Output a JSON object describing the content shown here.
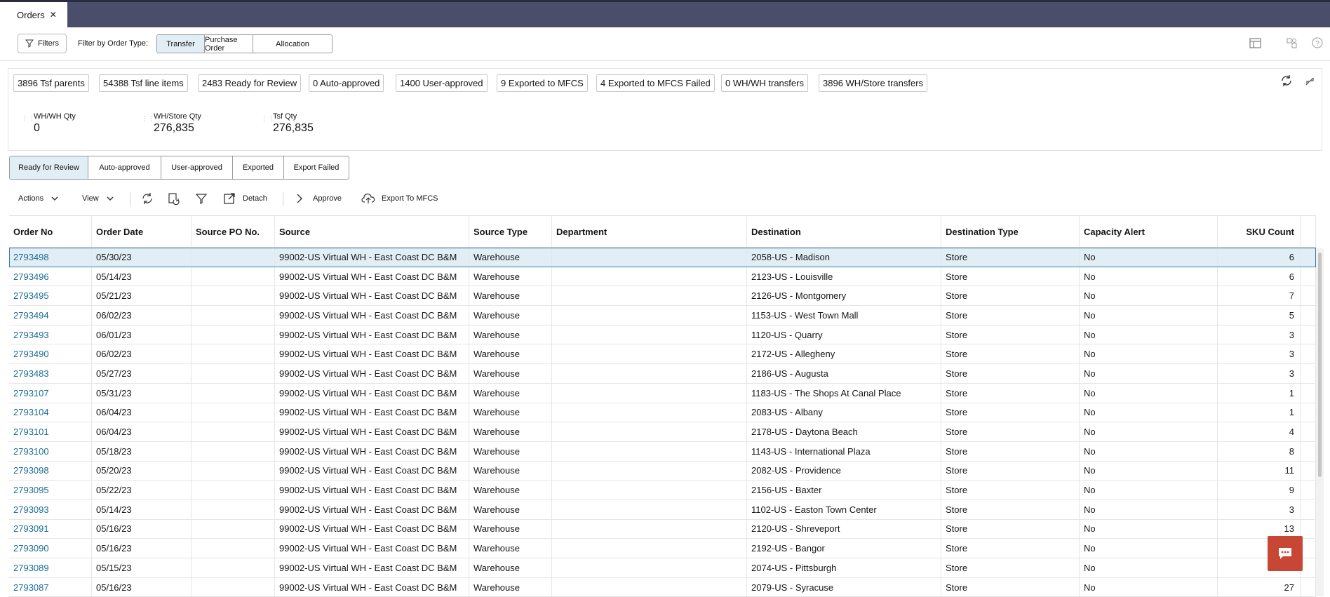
{
  "app": {
    "tab_label": "Orders",
    "tab_close": "✕"
  },
  "filterbar": {
    "filters_label": "Filters",
    "order_type_label": "Filter by Order Type:",
    "order_types": [
      "Transfer",
      "Purchase Order",
      "Allocation"
    ],
    "selected_order_type": "Transfer"
  },
  "summary_chips": [
    "3896 Tsf parents",
    "54388 Tsf line items",
    "2483 Ready for Review",
    "0 Auto-approved",
    "1400 User-approved",
    "9 Exported to MFCS",
    "4 Exported to MFCS Failed",
    "0 WH/WH transfers",
    "3896 WH/Store transfers"
  ],
  "metrics": [
    {
      "label": "WH/WH Qty",
      "value": "0"
    },
    {
      "label": "WH/Store Qty",
      "value": "276,835"
    },
    {
      "label": "Tsf Qty",
      "value": "276,835"
    }
  ],
  "status_tabs": [
    "Ready for Review",
    "Auto-approved",
    "User-approved",
    "Exported",
    "Export Failed"
  ],
  "selected_status_tab": "Ready for Review",
  "toolbar": {
    "actions_label": "Actions",
    "view_label": "View",
    "detach_label": "Detach",
    "approve_label": "Approve",
    "export_label": "Export To MFCS"
  },
  "table": {
    "columns": [
      "Order No",
      "Order Date",
      "Source PO No.",
      "Source",
      "Source Type",
      "Department",
      "Destination",
      "Destination Type",
      "Capacity Alert",
      "SKU Count"
    ],
    "rows": [
      {
        "order_no": "2793498",
        "order_date": "05/30/23",
        "source_po": "",
        "source": "99002-US Virtual WH - East Coast DC B&M",
        "source_type": "Warehouse",
        "department": "",
        "destination": "2058-US - Madison",
        "destination_type": "Store",
        "capacity_alert": "No",
        "sku_count": "6"
      },
      {
        "order_no": "2793496",
        "order_date": "05/14/23",
        "source_po": "",
        "source": "99002-US Virtual WH - East Coast DC B&M",
        "source_type": "Warehouse",
        "department": "",
        "destination": "2123-US - Louisville",
        "destination_type": "Store",
        "capacity_alert": "No",
        "sku_count": "6"
      },
      {
        "order_no": "2793495",
        "order_date": "05/21/23",
        "source_po": "",
        "source": "99002-US Virtual WH - East Coast DC B&M",
        "source_type": "Warehouse",
        "department": "",
        "destination": "2126-US - Montgomery",
        "destination_type": "Store",
        "capacity_alert": "No",
        "sku_count": "7"
      },
      {
        "order_no": "2793494",
        "order_date": "06/02/23",
        "source_po": "",
        "source": "99002-US Virtual WH - East Coast DC B&M",
        "source_type": "Warehouse",
        "department": "",
        "destination": "1153-US - West Town Mall",
        "destination_type": "Store",
        "capacity_alert": "No",
        "sku_count": "5"
      },
      {
        "order_no": "2793493",
        "order_date": "06/01/23",
        "source_po": "",
        "source": "99002-US Virtual WH - East Coast DC B&M",
        "source_type": "Warehouse",
        "department": "",
        "destination": "1120-US - Quarry",
        "destination_type": "Store",
        "capacity_alert": "No",
        "sku_count": "3"
      },
      {
        "order_no": "2793490",
        "order_date": "06/02/23",
        "source_po": "",
        "source": "99002-US Virtual WH - East Coast DC B&M",
        "source_type": "Warehouse",
        "department": "",
        "destination": "2172-US - Allegheny",
        "destination_type": "Store",
        "capacity_alert": "No",
        "sku_count": "3"
      },
      {
        "order_no": "2793483",
        "order_date": "05/27/23",
        "source_po": "",
        "source": "99002-US Virtual WH - East Coast DC B&M",
        "source_type": "Warehouse",
        "department": "",
        "destination": "2186-US - Augusta",
        "destination_type": "Store",
        "capacity_alert": "No",
        "sku_count": "3"
      },
      {
        "order_no": "2793107",
        "order_date": "05/31/23",
        "source_po": "",
        "source": "99002-US Virtual WH - East Coast DC B&M",
        "source_type": "Warehouse",
        "department": "",
        "destination": "1183-US - The Shops At Canal Place",
        "destination_type": "Store",
        "capacity_alert": "No",
        "sku_count": "1"
      },
      {
        "order_no": "2793104",
        "order_date": "06/04/23",
        "source_po": "",
        "source": "99002-US Virtual WH - East Coast DC B&M",
        "source_type": "Warehouse",
        "department": "",
        "destination": "2083-US - Albany",
        "destination_type": "Store",
        "capacity_alert": "No",
        "sku_count": "1"
      },
      {
        "order_no": "2793101",
        "order_date": "06/04/23",
        "source_po": "",
        "source": "99002-US Virtual WH - East Coast DC B&M",
        "source_type": "Warehouse",
        "department": "",
        "destination": "2178-US - Daytona Beach",
        "destination_type": "Store",
        "capacity_alert": "No",
        "sku_count": "4"
      },
      {
        "order_no": "2793100",
        "order_date": "05/18/23",
        "source_po": "",
        "source": "99002-US Virtual WH - East Coast DC B&M",
        "source_type": "Warehouse",
        "department": "",
        "destination": "1143-US - International Plaza",
        "destination_type": "Store",
        "capacity_alert": "No",
        "sku_count": "8"
      },
      {
        "order_no": "2793098",
        "order_date": "05/20/23",
        "source_po": "",
        "source": "99002-US Virtual WH - East Coast DC B&M",
        "source_type": "Warehouse",
        "department": "",
        "destination": "2082-US - Providence",
        "destination_type": "Store",
        "capacity_alert": "No",
        "sku_count": "11"
      },
      {
        "order_no": "2793095",
        "order_date": "05/22/23",
        "source_po": "",
        "source": "99002-US Virtual WH - East Coast DC B&M",
        "source_type": "Warehouse",
        "department": "",
        "destination": "2156-US - Baxter",
        "destination_type": "Store",
        "capacity_alert": "No",
        "sku_count": "9"
      },
      {
        "order_no": "2793093",
        "order_date": "05/14/23",
        "source_po": "",
        "source": "99002-US Virtual WH - East Coast DC B&M",
        "source_type": "Warehouse",
        "department": "",
        "destination": "1102-US - Easton Town Center",
        "destination_type": "Store",
        "capacity_alert": "No",
        "sku_count": "3"
      },
      {
        "order_no": "2793091",
        "order_date": "05/16/23",
        "source_po": "",
        "source": "99002-US Virtual WH - East Coast DC B&M",
        "source_type": "Warehouse",
        "department": "",
        "destination": "2120-US - Shreveport",
        "destination_type": "Store",
        "capacity_alert": "No",
        "sku_count": "13"
      },
      {
        "order_no": "2793090",
        "order_date": "05/16/23",
        "source_po": "",
        "source": "99002-US Virtual WH - East Coast DC B&M",
        "source_type": "Warehouse",
        "department": "",
        "destination": "2192-US - Bangor",
        "destination_type": "Store",
        "capacity_alert": "No",
        "sku_count": ""
      },
      {
        "order_no": "2793089",
        "order_date": "05/15/23",
        "source_po": "",
        "source": "99002-US Virtual WH - East Coast DC B&M",
        "source_type": "Warehouse",
        "department": "",
        "destination": "2074-US - Pittsburgh",
        "destination_type": "Store",
        "capacity_alert": "No",
        "sku_count": ""
      },
      {
        "order_no": "2793087",
        "order_date": "05/16/23",
        "source_po": "",
        "source": "99002-US Virtual WH - East Coast DC B&M",
        "source_type": "Warehouse",
        "department": "",
        "destination": "2079-US - Syracuse",
        "destination_type": "Store",
        "capacity_alert": "No",
        "sku_count": "27"
      }
    ]
  },
  "colors": {
    "topbar": "#4a4e6b",
    "selected": "#e2eef5",
    "link": "#1c6c95",
    "chat": "#c74634"
  }
}
